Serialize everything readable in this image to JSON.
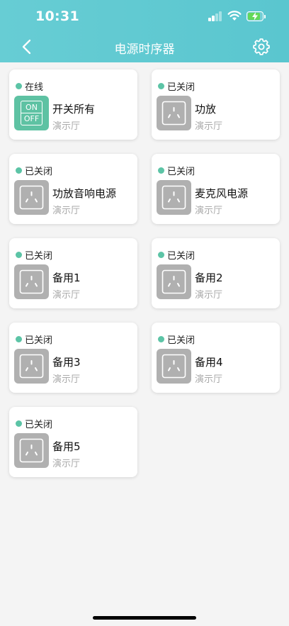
{
  "status_bar": {
    "time": "10:31"
  },
  "header": {
    "title": "电源时序器"
  },
  "power_all": {
    "label_on": "ON",
    "label_off": "OFF"
  },
  "devices": [
    {
      "state": "在线",
      "name": "开关所有",
      "room": "演示厅",
      "icon": "on-off-switch-icon"
    },
    {
      "state": "已关闭",
      "name": "功放",
      "room": "演示厅",
      "icon": "power-socket-icon"
    },
    {
      "state": "已关闭",
      "name": "功放音响电源",
      "room": "演示厅",
      "icon": "power-socket-icon"
    },
    {
      "state": "已关闭",
      "name": "麦克风电源",
      "room": "演示厅",
      "icon": "power-socket-icon"
    },
    {
      "state": "已关闭",
      "name": "备用1",
      "room": "演示厅",
      "icon": "power-socket-icon"
    },
    {
      "state": "已关闭",
      "name": "备用2",
      "room": "演示厅",
      "icon": "power-socket-icon"
    },
    {
      "state": "已关闭",
      "name": "备用3",
      "room": "演示厅",
      "icon": "power-socket-icon"
    },
    {
      "state": "已关闭",
      "name": "备用4",
      "room": "演示厅",
      "icon": "power-socket-icon"
    },
    {
      "state": "已关闭",
      "name": "备用5",
      "room": "演示厅",
      "icon": "power-socket-icon"
    }
  ],
  "colors": {
    "header": "#5ac6cf",
    "status_dot": "#5cc4a6",
    "switch_on": "#5ec2a3",
    "socket_off": "#b0b0b0"
  }
}
